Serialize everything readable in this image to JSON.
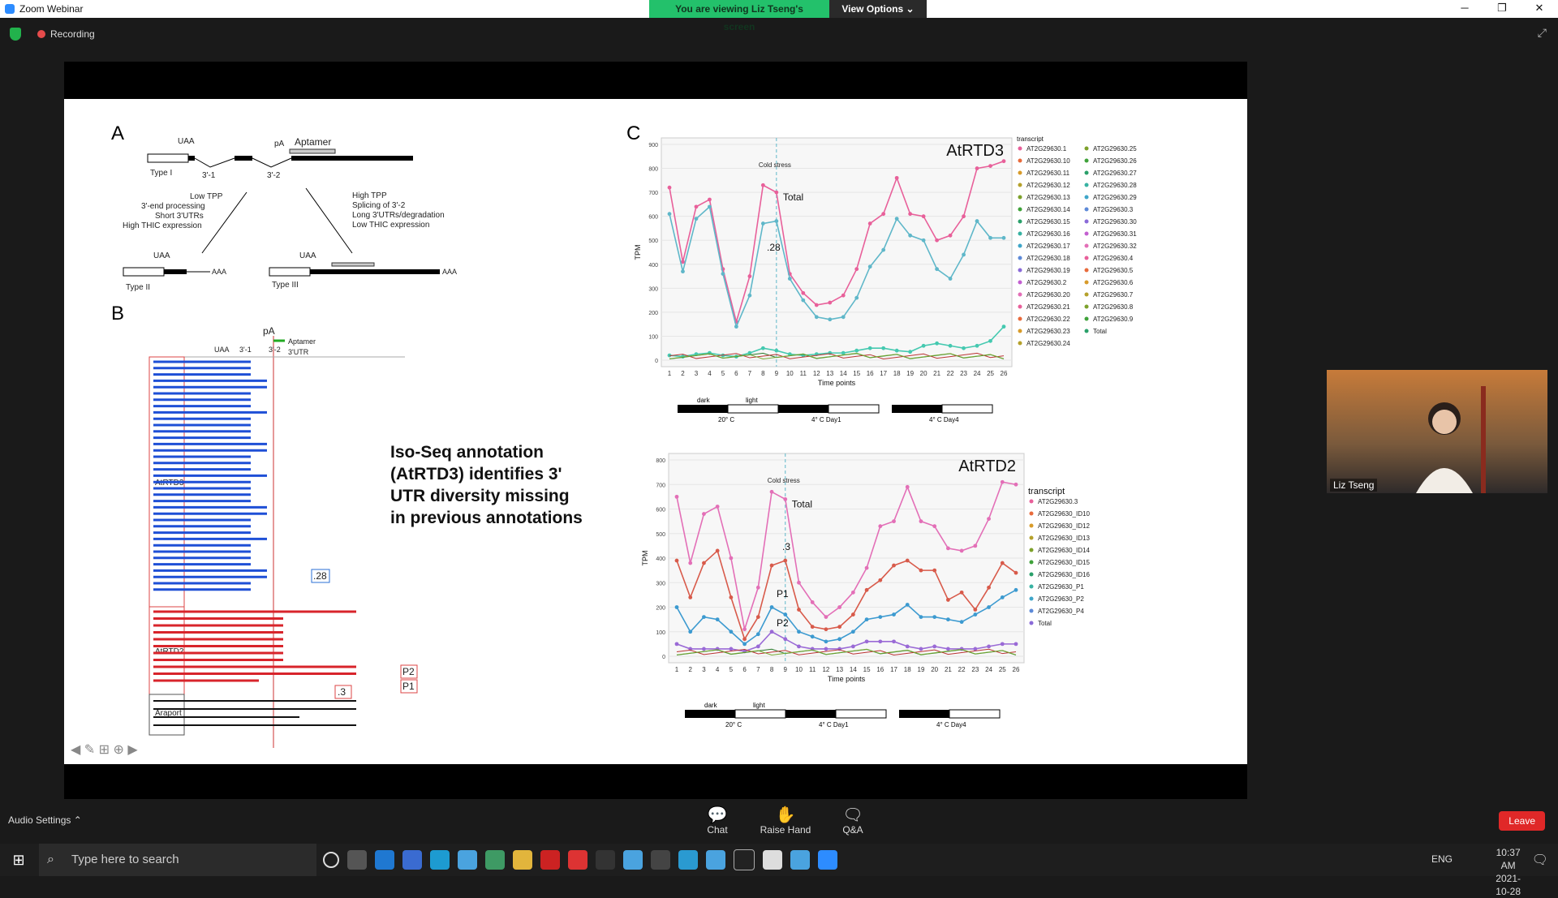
{
  "window": {
    "app_title": "Zoom Webinar",
    "banner_text": "You are viewing Liz Tseng's screen",
    "view_options": "View Options",
    "controls": [
      "─",
      "❐",
      "✕"
    ]
  },
  "status": {
    "recording": "Recording"
  },
  "slide": {
    "panel_A_label": "A",
    "panel_B_label": "B",
    "panel_C_label": "C",
    "panel_A": {
      "uaa": "UAA",
      "pa": "pA",
      "aptamer": "Aptamer",
      "type1": "Type I",
      "s31": "3'-1",
      "s32": "3'-2",
      "left_note": [
        "Low TPP",
        "3'-end processing",
        "Short 3'UTRs",
        "High THIC expression"
      ],
      "right_note": [
        "High TPP",
        "Splicing of 3'-2",
        "Long 3'UTRs/degradation",
        "Low THIC expression"
      ],
      "type2": "Type II",
      "type3": "Type III",
      "aaa": "AAA"
    },
    "panel_B": {
      "pa": "pA",
      "aptamer": "Aptamer",
      "utr": "3'UTR",
      "uaa": "UAA",
      "s31": "3'-1",
      "s32": "3'-2",
      "row_atrtd3": "AtRTD3",
      "row_atrtd2": "AtRTD2",
      "row_araport": "Araport",
      "callout_28": ".28",
      "callout_3": ".3",
      "p1": "P1",
      "p2": "P2"
    },
    "iso_text": "Iso-Seq annotation (AtRTD3) identifies 3' UTR diversity missing in previous annotations"
  },
  "chart_data": [
    {
      "type": "line",
      "title": "AtRTD3",
      "ylabel": "TPM",
      "xlabel": "Time points",
      "annotation_cold": "Cold stress",
      "annotation_total": "Total",
      "annotation_28": ".28",
      "ylim": [
        0,
        900
      ],
      "x": [
        1,
        2,
        3,
        4,
        5,
        6,
        7,
        8,
        9,
        10,
        11,
        12,
        13,
        14,
        15,
        16,
        17,
        18,
        19,
        20,
        21,
        22,
        23,
        24,
        25,
        26
      ],
      "series": [
        {
          "name": "Total",
          "color": "#e8609a",
          "values": [
            720,
            410,
            640,
            670,
            380,
            160,
            350,
            730,
            700,
            360,
            280,
            230,
            240,
            270,
            380,
            570,
            610,
            760,
            610,
            600,
            500,
            520,
            600,
            800,
            810,
            830
          ]
        },
        {
          "name": "AT2G29630.28",
          "color": "#5fb7c9",
          "values": [
            610,
            370,
            590,
            640,
            360,
            140,
            270,
            570,
            580,
            340,
            250,
            180,
            170,
            180,
            260,
            390,
            460,
            590,
            520,
            500,
            380,
            340,
            440,
            580,
            510,
            510
          ]
        },
        {
          "name": "AT2G29630.23",
          "color": "#45c9b0",
          "values": [
            20,
            15,
            25,
            30,
            20,
            15,
            30,
            50,
            40,
            25,
            20,
            25,
            30,
            30,
            40,
            50,
            50,
            40,
            35,
            60,
            70,
            60,
            50,
            60,
            80,
            140
          ]
        }
      ],
      "legend_title": "transcript",
      "legend_entries": [
        "AT2G29630.1",
        "AT2G29630.10",
        "AT2G29630.11",
        "AT2G29630.12",
        "AT2G29630.13",
        "AT2G29630.14",
        "AT2G29630.15",
        "AT2G29630.16",
        "AT2G29630.17",
        "AT2G29630.18",
        "AT2G29630.19",
        "AT2G29630.2",
        "AT2G29630.20",
        "AT2G29630.21",
        "AT2G29630.22",
        "AT2G29630.23",
        "AT2G29630.24",
        "AT2G29630.25",
        "AT2G29630.26",
        "AT2G29630.27",
        "AT2G29630.28",
        "AT2G29630.29",
        "AT2G29630.3",
        "AT2G29630.30",
        "AT2G29630.31",
        "AT2G29630.32",
        "AT2G29630.4",
        "AT2G29630.5",
        "AT2G29630.6",
        "AT2G29630.7",
        "AT2G29630.8",
        "AT2G29630.9",
        "Total"
      ],
      "light_bar": {
        "dark": "dark",
        "light": "light",
        "t20": "20° C",
        "day1": "4° C Day1",
        "day4": "4° C Day4"
      }
    },
    {
      "type": "line",
      "title": "AtRTD2",
      "ylabel": "TPM",
      "xlabel": "Time points",
      "annotation_cold": "Cold stress",
      "annotation_total": "Total",
      "annotation_3": ".3",
      "annotation_p1": "P1",
      "annotation_p2": "P2",
      "ylim": [
        0,
        800
      ],
      "x": [
        1,
        2,
        3,
        4,
        5,
        6,
        7,
        8,
        9,
        10,
        11,
        12,
        13,
        14,
        15,
        16,
        17,
        18,
        19,
        20,
        21,
        22,
        23,
        24,
        25,
        26
      ],
      "series": [
        {
          "name": "Total",
          "color": "#e36fb7",
          "values": [
            650,
            380,
            580,
            610,
            400,
            110,
            280,
            670,
            640,
            300,
            220,
            160,
            200,
            260,
            360,
            530,
            550,
            690,
            550,
            530,
            440,
            430,
            450,
            560,
            710,
            700
          ]
        },
        {
          "name": "AT2G29630.3",
          "color": "#d85a4a",
          "values": [
            390,
            240,
            380,
            430,
            240,
            70,
            160,
            370,
            390,
            190,
            120,
            110,
            120,
            170,
            270,
            310,
            370,
            390,
            350,
            350,
            230,
            260,
            190,
            280,
            380,
            340
          ]
        },
        {
          "name": "AT2G29630_P1",
          "color": "#3c9ad0",
          "values": [
            200,
            100,
            160,
            150,
            100,
            50,
            90,
            200,
            170,
            100,
            80,
            60,
            70,
            100,
            150,
            160,
            170,
            210,
            160,
            160,
            150,
            140,
            170,
            200,
            240,
            270
          ]
        },
        {
          "name": "AT2G29630_P2",
          "color": "#9a6ad6",
          "values": [
            50,
            30,
            30,
            30,
            30,
            20,
            40,
            100,
            70,
            40,
            30,
            30,
            30,
            40,
            60,
            60,
            60,
            40,
            30,
            40,
            30,
            30,
            30,
            40,
            50,
            50
          ]
        }
      ],
      "legend_title": "transcript",
      "legend_entries": [
        "AT2G29630.3",
        "AT2G29630_ID10",
        "AT2G29630_ID12",
        "AT2G29630_ID13",
        "AT2G29630_ID14",
        "AT2G29630_ID15",
        "AT2G29630_ID16",
        "AT2G29630_P1",
        "AT2G29630_P2",
        "AT2G29630_P4",
        "Total"
      ],
      "light_bar": {
        "dark": "dark",
        "light": "light",
        "t20": "20° C",
        "day1": "4° C Day1",
        "day4": "4° C Day4"
      }
    }
  ],
  "video": {
    "name": "Liz Tseng"
  },
  "bottom": {
    "audio_settings": "Audio Settings",
    "chat": "Chat",
    "raise_hand": "Raise Hand",
    "qa": "Q&A",
    "leave": "Leave"
  },
  "taskbar": {
    "search_placeholder": "Type here to search",
    "lang": "ENG",
    "time": "10:37 AM",
    "date": "2021-10-28"
  }
}
